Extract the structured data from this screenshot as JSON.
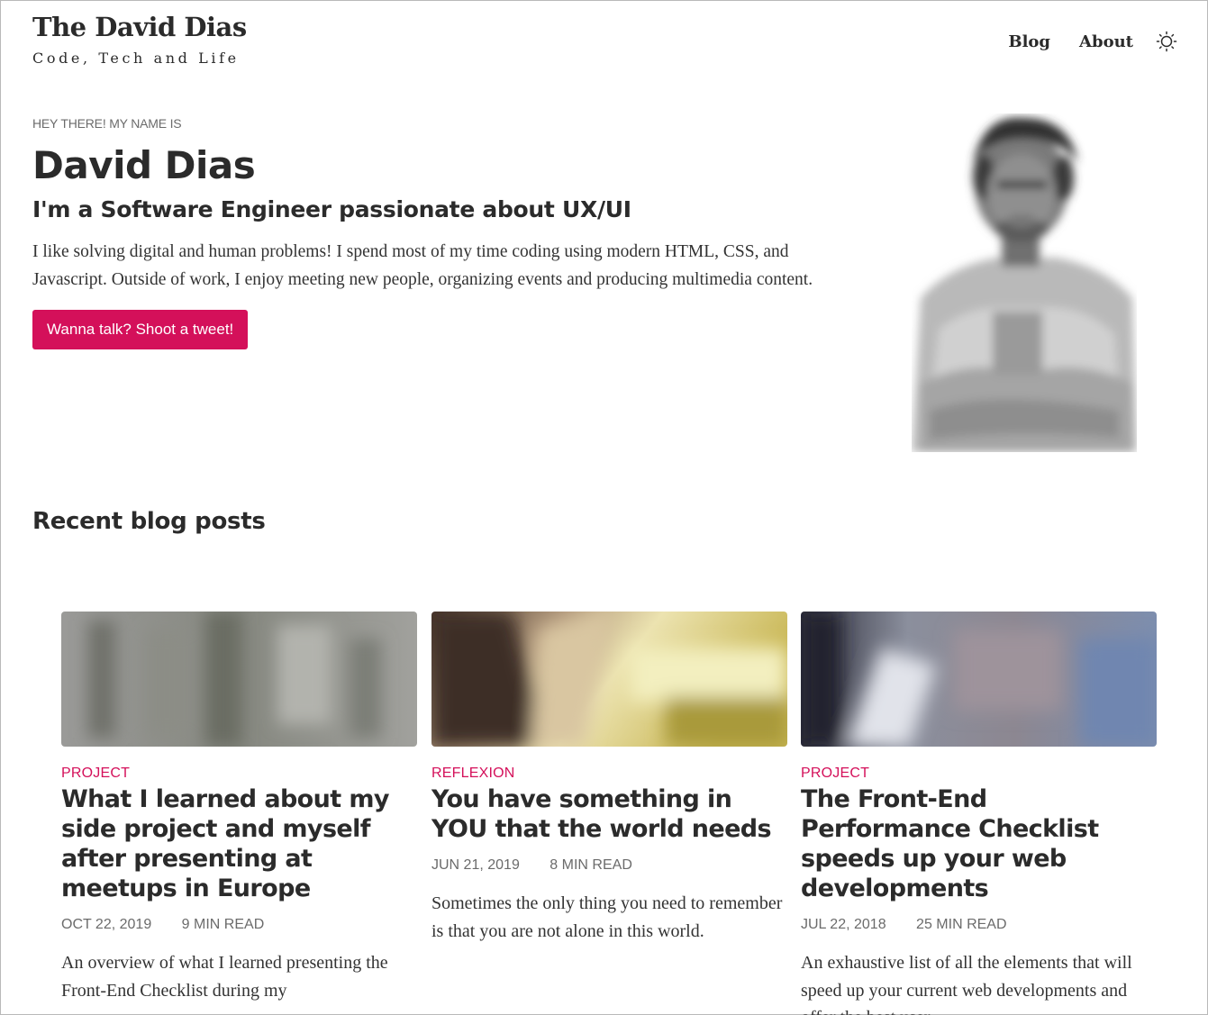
{
  "header": {
    "site_title": "The David Dias",
    "tagline": "Code, Tech and Life",
    "nav": [
      {
        "label": "Blog"
      },
      {
        "label": "About"
      }
    ],
    "theme_toggle_icon": "sun-icon"
  },
  "hero": {
    "eyebrow": "HEY THERE! MY NAME IS",
    "name": "David Dias",
    "subtitle": "I'm a Software Engineer passionate about UX/UI",
    "bio": "I like solving digital and human problems! I spend most of my time coding using modern HTML, CSS, and Javascript. Outside of work, I enjoy meeting new people, organizing events and producing multimedia content.",
    "cta_label": "Wanna talk? Shoot a tweet!"
  },
  "recent_posts": {
    "heading": "Recent blog posts",
    "posts": [
      {
        "category": "PROJECT",
        "title": "What I learned about my side project and myself after presenting at meetups in Europe",
        "date": "OCT 22, 2019",
        "read_time": "9 MIN READ",
        "excerpt": "An overview of what I learned presenting the Front-End Checklist during my"
      },
      {
        "category": "REFLEXION",
        "title": "You have something in YOU that the world needs",
        "date": "JUN 21, 2019",
        "read_time": "8 MIN READ",
        "excerpt": "Sometimes the only thing you need to remember is that you are not alone in this world."
      },
      {
        "category": "PROJECT",
        "title": "The Front-End Performance Checklist speeds up your web developments",
        "date": "JUL 22, 2018",
        "read_time": "25 MIN READ",
        "excerpt": "An exhaustive list of all the elements that will speed up your current web developments and offer the best user"
      }
    ]
  },
  "colors": {
    "accent": "#d4105a",
    "text": "#2b2b2b",
    "muted": "#6b6b6b"
  }
}
